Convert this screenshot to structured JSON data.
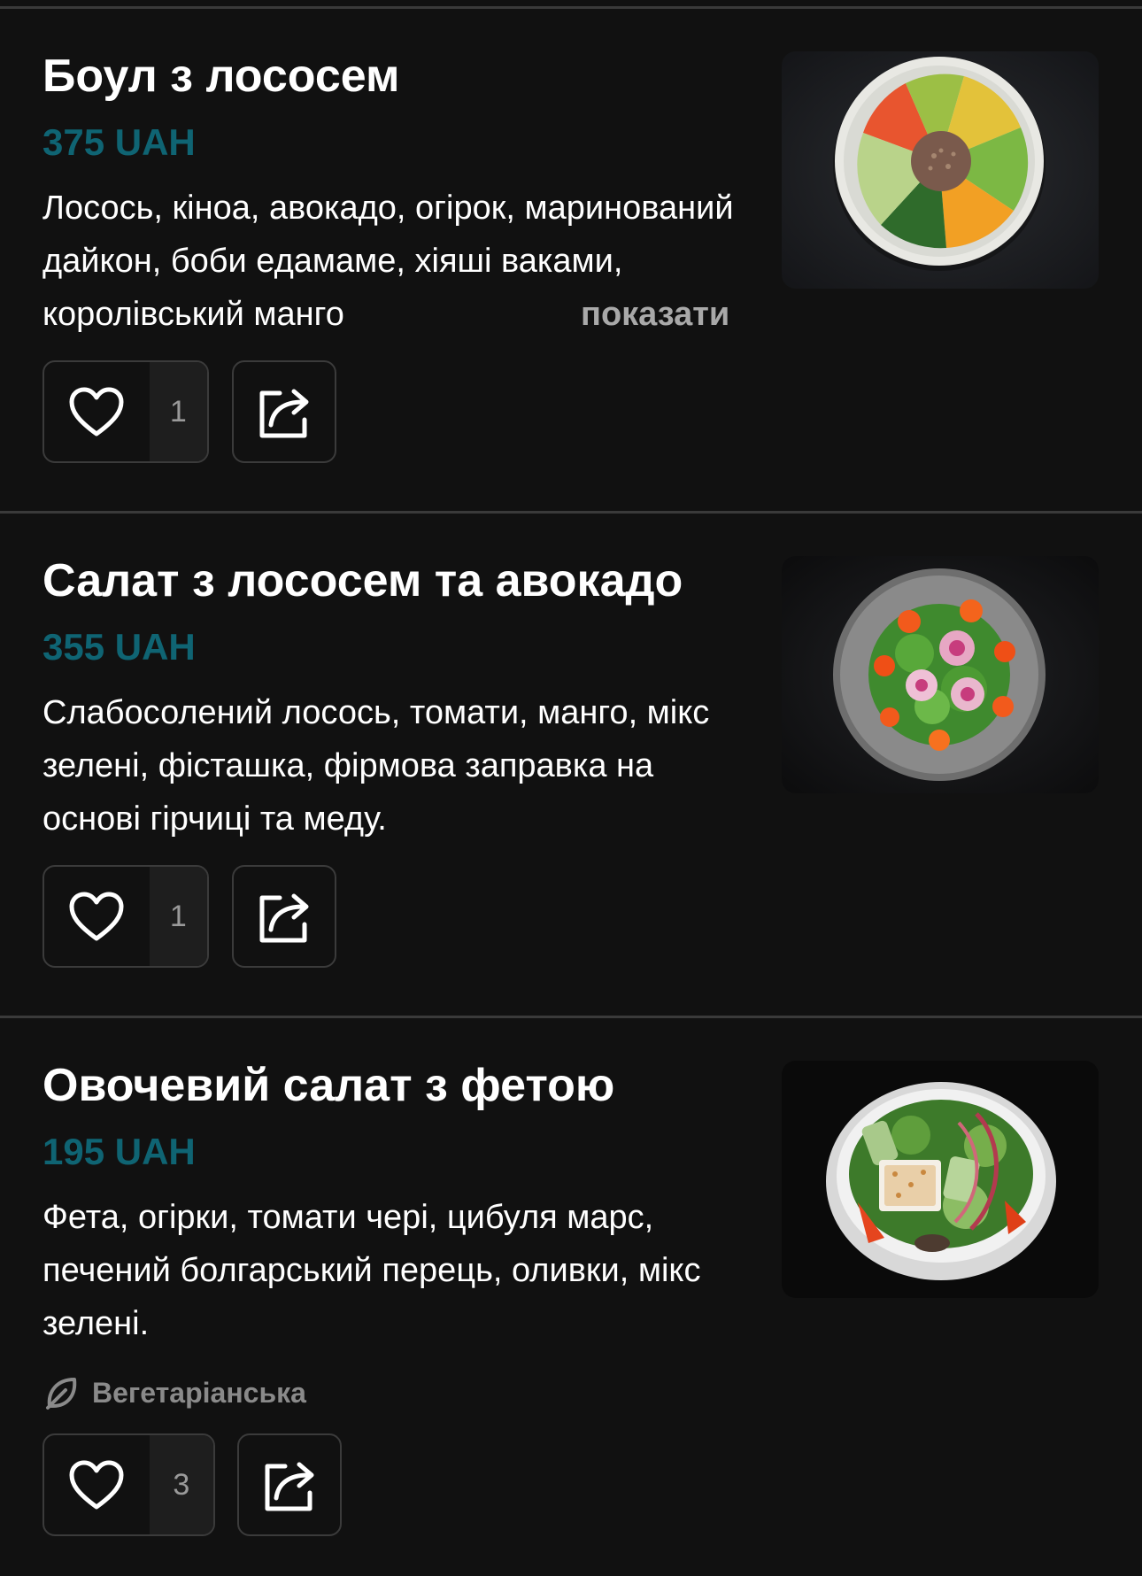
{
  "colors": {
    "background": "#111111",
    "price": "#0f6473",
    "divider": "#3a3a3a",
    "muted": "#8a8a8a"
  },
  "items": [
    {
      "title": "Боул з лососем",
      "price": "375 UAH",
      "description": "Лосось, кіноа, авокадо, огірок, маринований дайкон, боби едамаме, хіяші ваками, королівський манго",
      "show_more": "показати",
      "likes": "1",
      "image_icon": "poke-bowl-photo"
    },
    {
      "title": "Салат з лососем та авокадо",
      "price": "355 UAH",
      "description": "Слабосолений лосось, томати, манго, мікс зелені, фісташка, фірмова заправка на основі гірчиці та меду.",
      "likes": "1",
      "image_icon": "salmon-salad-photo"
    },
    {
      "title": "Овочевий салат з фетою",
      "price": "195 UAH",
      "description": "Фета, огірки, томати чері, цибуля марс, печений болгарський перець, оливки, мікс зелені.",
      "tag": "Вегетаріанська",
      "tag_icon": "leaf-icon",
      "likes": "3",
      "image_icon": "feta-salad-photo"
    }
  ]
}
